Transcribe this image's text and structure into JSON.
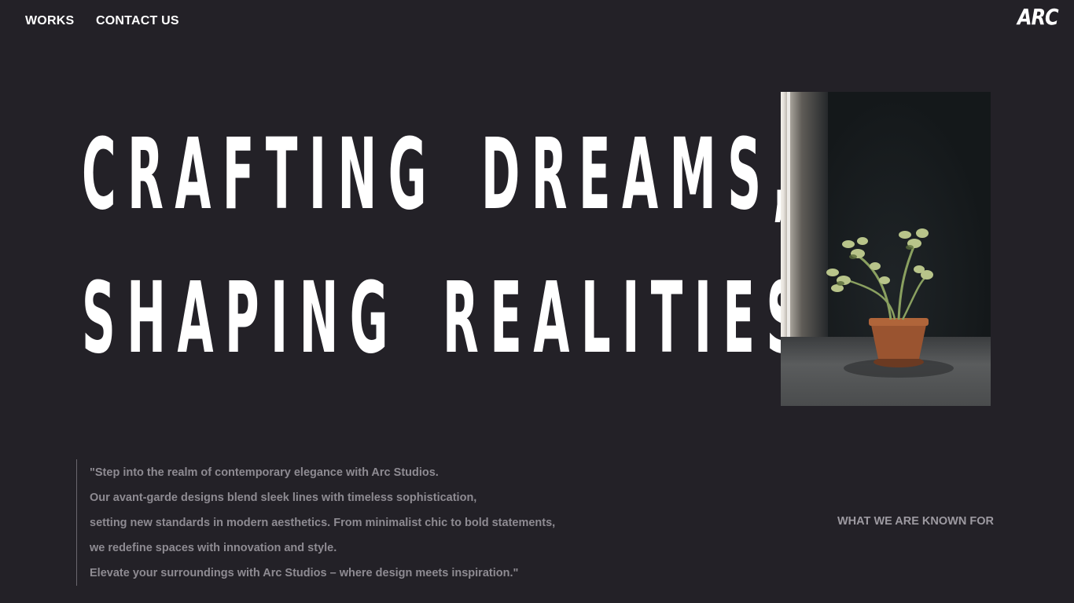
{
  "nav": {
    "works_label": "WORKS",
    "contact_label": "CONTACT US",
    "logo_text": "ARC"
  },
  "hero": {
    "headline_line1": "CRAFTING DREAMS,",
    "headline_line2": "SHAPING REALITIES.",
    "image_description_icon": "potted-plant-photo"
  },
  "quote": {
    "lines": [
      "\"Step into the realm of contemporary elegance with Arc Studios.",
      "Our avant-garde designs blend sleek lines with timeless sophistication,",
      "setting new standards in modern aesthetics. From minimalist chic to bold statements,",
      "we redefine spaces with innovation and style.",
      "Elevate your surroundings with Arc Studios – where design meets inspiration.\""
    ]
  },
  "known_for": {
    "label": "WHAT WE ARE KNOWN FOR"
  },
  "colors": {
    "background": "#232127",
    "text_primary": "#ffffff",
    "text_muted": "#8e8b92"
  }
}
